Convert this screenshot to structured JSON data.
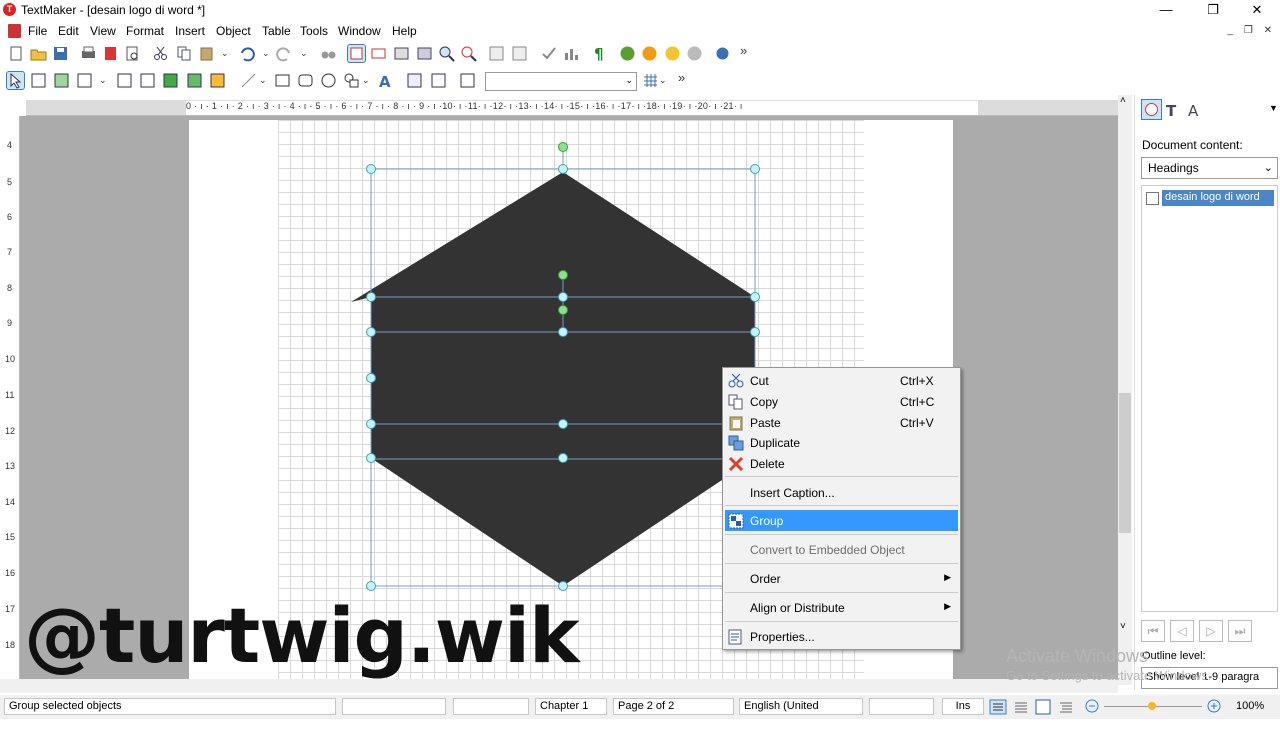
{
  "window": {
    "title": "TextMaker - [desain logo di word *]",
    "minimize": "—",
    "restore": "❐",
    "close": "✕"
  },
  "menu": [
    "File",
    "Edit",
    "View",
    "Format",
    "Insert",
    "Object",
    "Table",
    "Tools",
    "Window",
    "Help"
  ],
  "toolbar": {
    "overflow": "»"
  },
  "ruler": {
    "ticks": "0 · ı · 1 · ı · 2 · ı · 3 · ı · 4 · ı · 5 · ı · 6 · ı · 7 · ı · 8 · ı · 9 · ı ·10· ı ·11· ı ·12· ı ·13· ı ·14· ı ·15· ı ·16· ı ·17· ı ·18· ı ·19· ı ·20· ı ·21· ı",
    "vertical": [
      "4",
      "5",
      "6",
      "7",
      "8",
      "9",
      "10",
      "11",
      "12",
      "13",
      "14",
      "15",
      "16",
      "17",
      "18"
    ]
  },
  "sidebar": {
    "document_content_label": "Document content:",
    "document_content_value": "Headings",
    "items": [
      {
        "label": "desain logo di word"
      }
    ],
    "outline_label": "Outline level:",
    "outline_value": "Show level 1-9 paragra"
  },
  "context_menu": {
    "items": [
      {
        "label": "Cut",
        "shortcut": "Ctrl+X",
        "icon": "scissors-icon"
      },
      {
        "label": "Copy",
        "shortcut": "Ctrl+C",
        "icon": "copy-icon"
      },
      {
        "label": "Paste",
        "shortcut": "Ctrl+V",
        "icon": "paste-icon"
      },
      {
        "label": "Duplicate",
        "shortcut": "",
        "icon": "duplicate-icon"
      },
      {
        "label": "Delete",
        "shortcut": "",
        "icon": "delete-icon"
      },
      {
        "label": "Insert Caption...",
        "shortcut": ""
      },
      {
        "label": "Group",
        "shortcut": "",
        "icon": "group-icon",
        "highlighted": true
      },
      {
        "label": "Convert to Embedded Object",
        "shortcut": "",
        "disabled": true
      },
      {
        "label": "Order",
        "submenu": true
      },
      {
        "label": "Align or Distribute",
        "submenu": true
      },
      {
        "label": "Properties...",
        "shortcut": "",
        "icon": "properties-icon"
      }
    ]
  },
  "overlay_text": "@turtwig.wik",
  "watermark": {
    "line1": "Activate Windows",
    "line2": "Go to Settings to activate Windows."
  },
  "status": {
    "message": "Group selected objects",
    "chapter": "Chapter 1",
    "page": "Page 2 of 2",
    "language": "English (United",
    "mode": "Ins",
    "zoom": "100%"
  },
  "colors": {
    "shape_fill": "#333333",
    "selection": "#3399ff",
    "handle": "#bff5fb",
    "rotate_handle": "#8de08d"
  }
}
